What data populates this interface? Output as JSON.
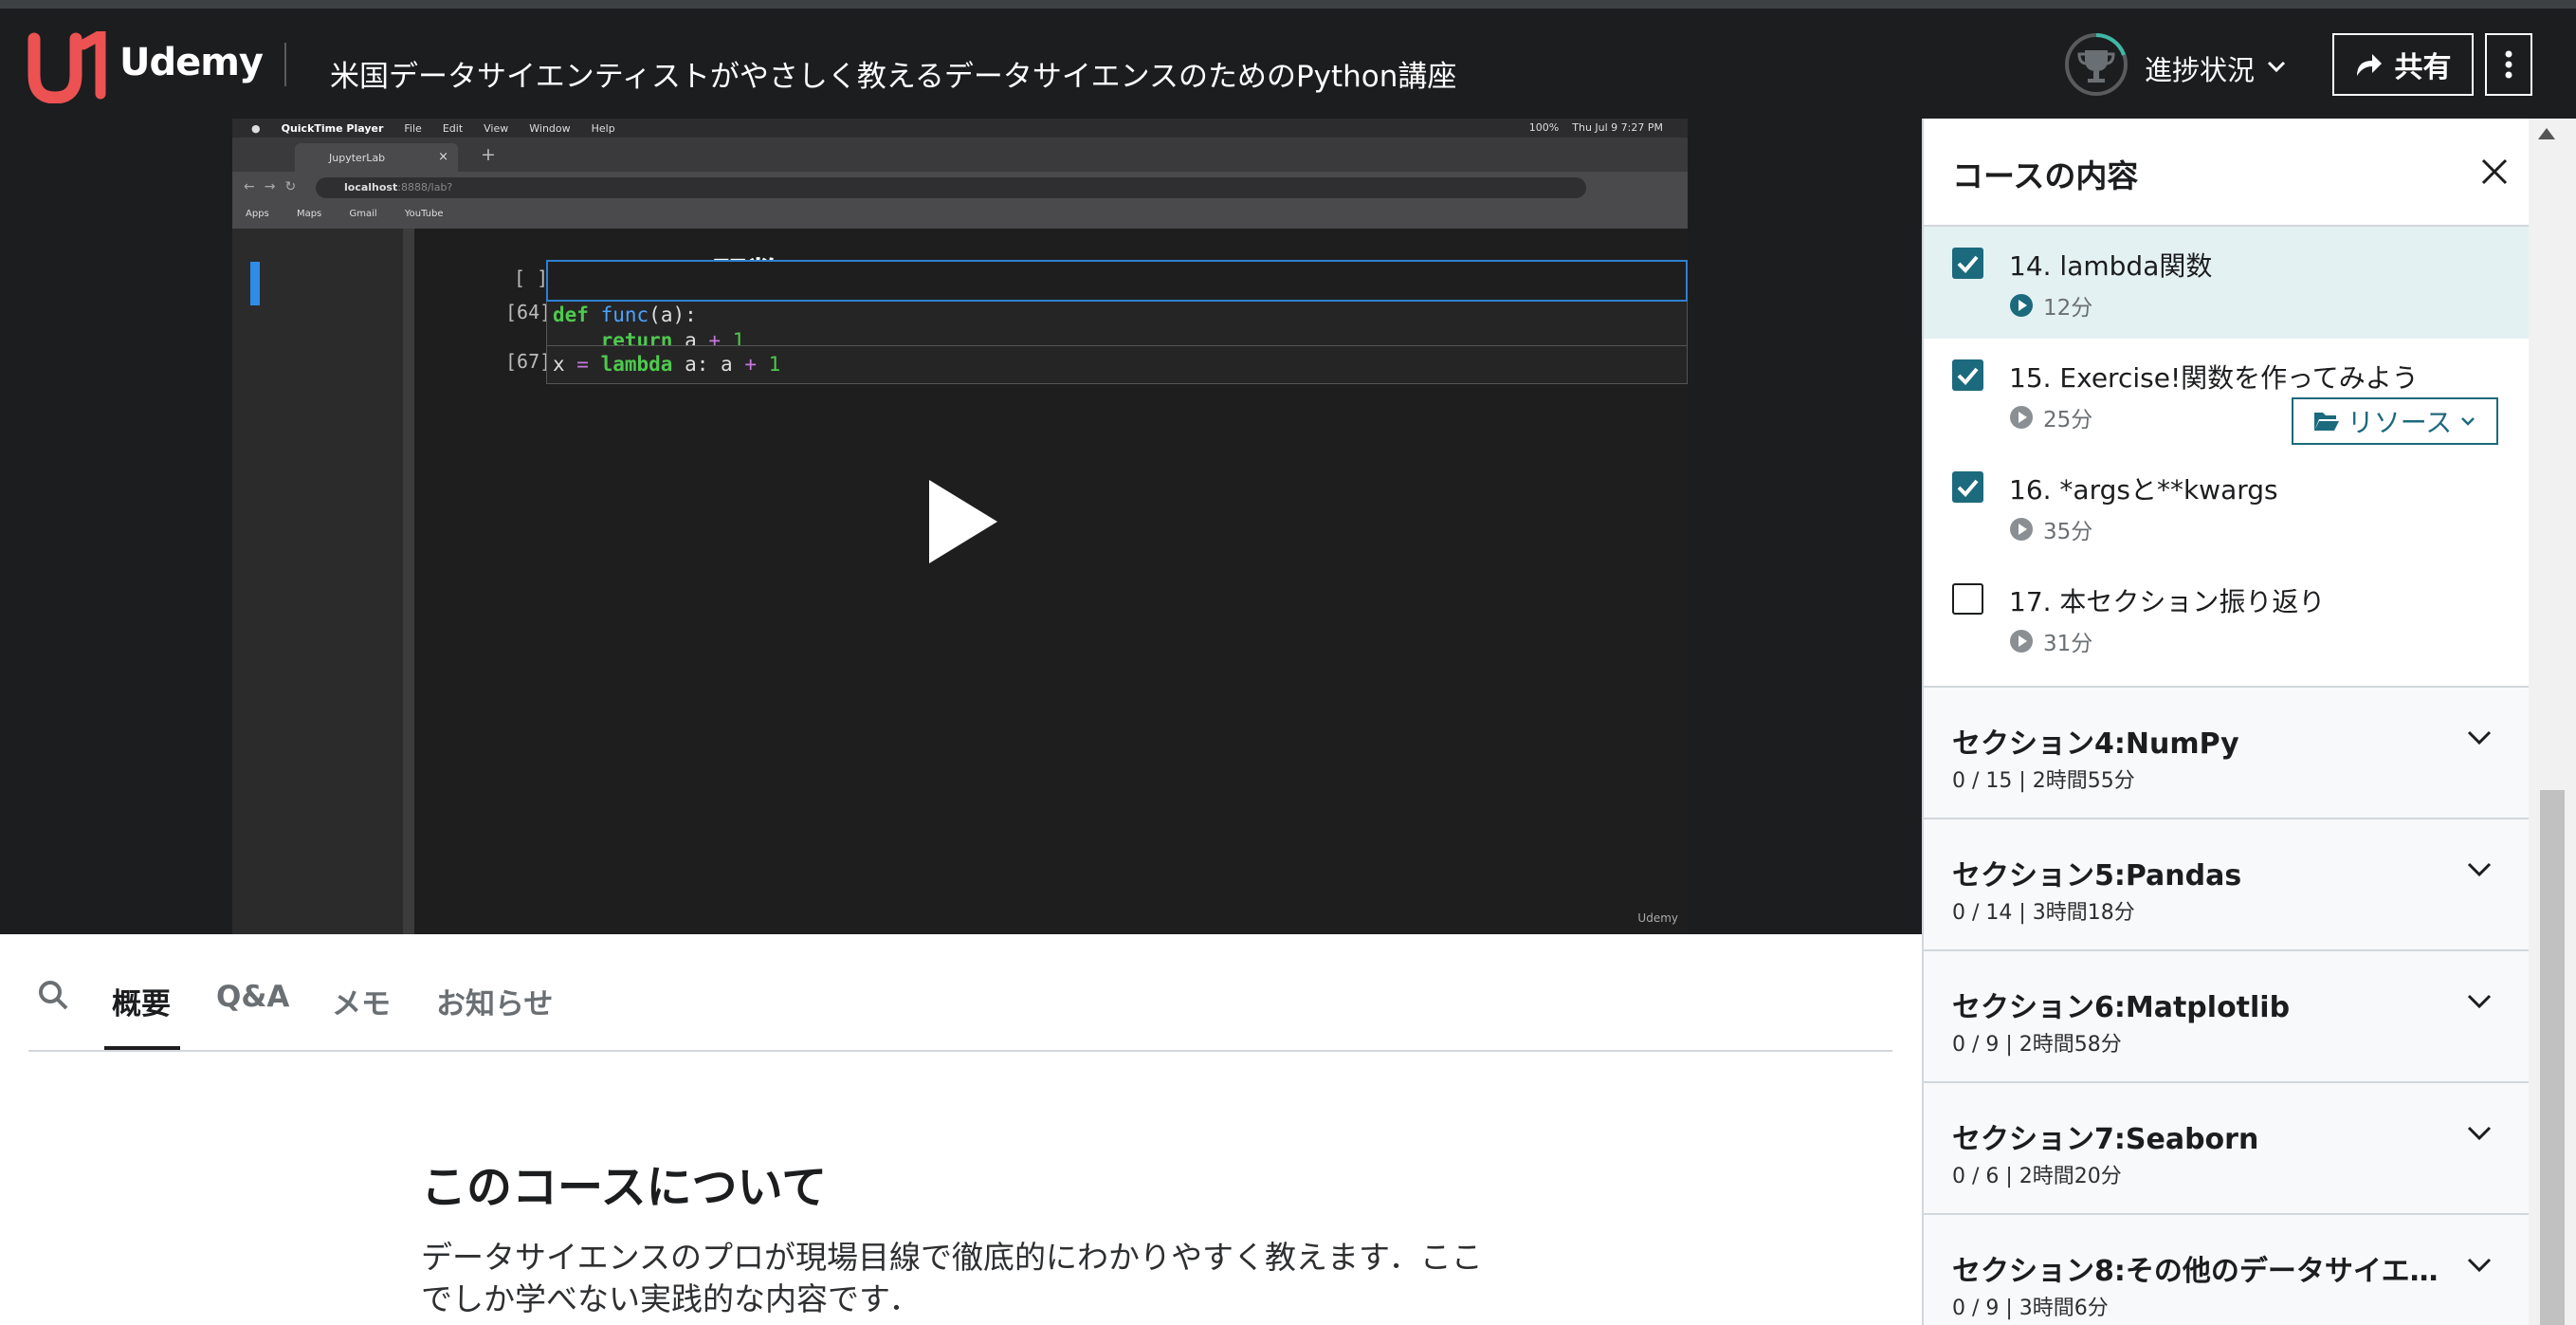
{
  "header": {
    "logo_text": "Udemy",
    "course_title": "米国データサイエンティストがやさしく教えるデータサイエンスのためのPython講座",
    "progress_label": "進捗状況",
    "share_label": "共有",
    "colors": {
      "bg": "#1c1d1f",
      "logo": "#a435f0",
      "progress_arc": "#3db9a5"
    }
  },
  "video": {
    "menubar": {
      "app": "QuickTime Player",
      "items": [
        "File",
        "Edit",
        "View",
        "Window",
        "Help"
      ],
      "clock": "Thu Jul 9  7:27 PM",
      "battery": "100%"
    },
    "browser": {
      "tab_title": "JupyterLab",
      "url_host": "localhost",
      "url_rest": ":8888/lab?",
      "bookmarks": [
        "Apps",
        "Maps",
        "Gmail",
        "YouTube"
      ]
    },
    "notebook": {
      "heading": "Lambda関数",
      "cell1_prompt": "[64]:",
      "cell2_prompt": "[67]:",
      "cell3_prompt": "[ ]:",
      "code1_line1": {
        "kw": "def",
        "fn": "func",
        "rest": "(a):"
      },
      "code1_line2": {
        "indent": "    ",
        "kw": "return",
        "mid": " a ",
        "op": "+",
        "num": " 1"
      },
      "code2": {
        "var": "x ",
        "eq": "=",
        "kw": " lambda",
        "mid": " a: a ",
        "op": "+",
        "num": " 1"
      }
    },
    "watermark": "Udemy"
  },
  "tabs": {
    "items": [
      "概要",
      "Q&A",
      "メモ",
      "お知らせ"
    ],
    "active": "概要"
  },
  "about": {
    "title": "このコースについて",
    "description": "データサイエンスのプロが現場目線で徹底的にわかりやすく教えます．ここでしか学べない実践的な内容です．"
  },
  "sidebar": {
    "title": "コースの内容",
    "lectures": [
      {
        "title": "14. lambda関数",
        "duration": "12分",
        "checked": true,
        "current": true
      },
      {
        "title": "15. Exercise!関数を作ってみよう",
        "duration": "25分",
        "checked": true,
        "current": false,
        "resource_label": "リソース"
      },
      {
        "title": "16. *argsと**kwargs",
        "duration": "35分",
        "checked": true,
        "current": false
      },
      {
        "title": "17. 本セクション振り返り",
        "duration": "31分",
        "checked": false,
        "current": false
      }
    ],
    "sections": [
      {
        "title": "セクション4:NumPy",
        "meta": "0 / 15 | 2時間55分"
      },
      {
        "title": "セクション5:Pandas",
        "meta": "0 / 14 | 3時間18分"
      },
      {
        "title": "セクション6:Matplotlib",
        "meta": "0 / 9 | 2時間58分"
      },
      {
        "title": "セクション7:Seaborn",
        "meta": "0 / 6 | 2時間20分"
      },
      {
        "title": "セクション8:その他のデータサイエ…",
        "meta": "0 / 9 | 3時間6分"
      }
    ],
    "colors": {
      "checkbox": "#1c6a7d",
      "current_bg": "#e4f1f3"
    }
  }
}
